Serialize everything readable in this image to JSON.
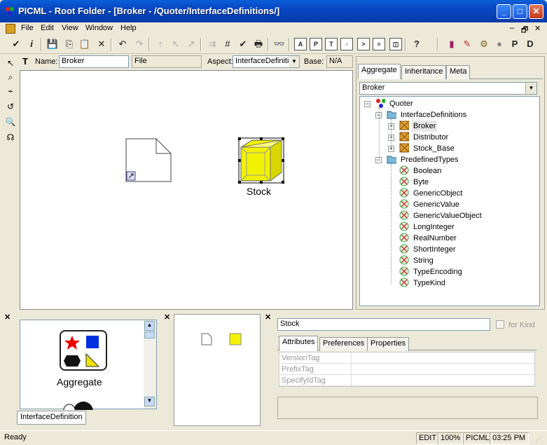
{
  "window": {
    "title": "PICML - Root Folder - [Broker - /Quoter/InterfaceDefinitions/]"
  },
  "menu": [
    "File",
    "Edit",
    "View",
    "Window",
    "Help"
  ],
  "namebar": {
    "name_label": "Name:",
    "name_value": "Broker",
    "type_value": "File",
    "aspect_label": "Aspect:",
    "aspect_value": "InterfaceDefiniti",
    "base_label": "Base:",
    "base_value": "N/A"
  },
  "canvas": {
    "stock_label": "Stock"
  },
  "browser": {
    "tabs": [
      "Aggregate",
      "Inheritance",
      "Meta"
    ],
    "selector_value": "Broker",
    "tree": {
      "root": "Quoter",
      "folder1": "InterfaceDefinitions",
      "folder1_items": [
        "Broker",
        "Distributor",
        "Stock_Base"
      ],
      "folder2": "PredefinedTypes",
      "folder2_items": [
        "Boolean",
        "Byte",
        "GenericObject",
        "GenericValue",
        "GenericValueObject",
        "LongInteger",
        "RealNumber",
        "ShortInteger",
        "String",
        "TypeEncoding",
        "TypeKind"
      ]
    }
  },
  "parts": {
    "label": "Aggregate",
    "tab": "InterfaceDefinition"
  },
  "attributes": {
    "name_value": "Stock",
    "for_kind_label": "for Kind",
    "tabs": [
      "Attributes",
      "Preferences",
      "Properties"
    ],
    "rows": [
      "VersionTag",
      "PrefixTag",
      "SpecifyIdTag"
    ]
  },
  "status": {
    "text": "Ready",
    "mode": "EDIT",
    "zoom": "100%",
    "paradigm": "PICML",
    "time": "03:25 PM"
  },
  "colors": {
    "title_blue": "#0846c2",
    "stock_yellow": "#f2f200"
  }
}
